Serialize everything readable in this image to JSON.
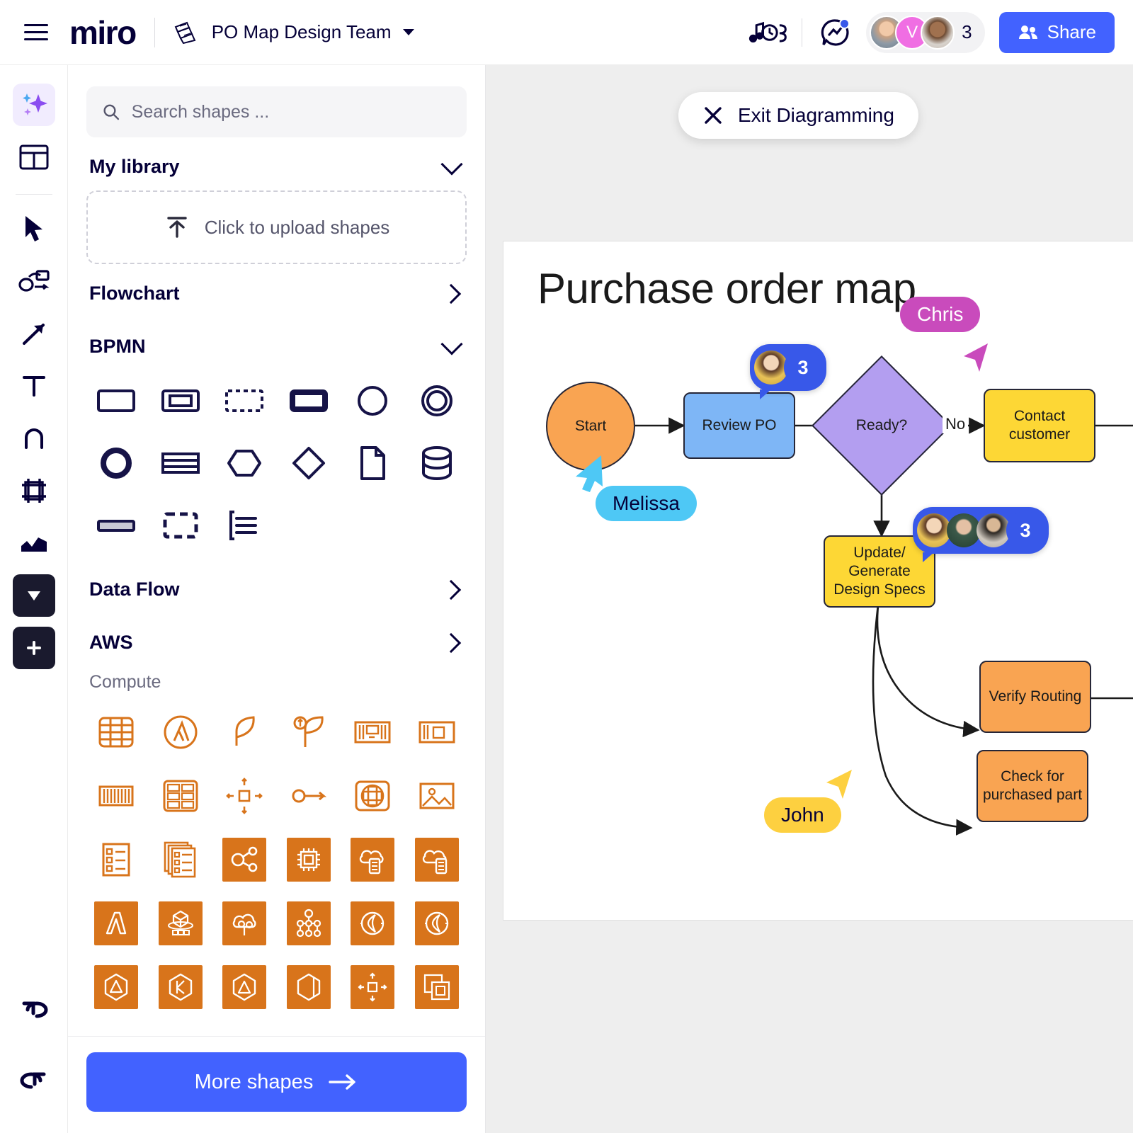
{
  "header": {
    "logo_text": "miro",
    "board_name": "PO Map Design Team",
    "board_icon": "book-icon",
    "menu_icon": "hamburger-menu-icon",
    "board_chevron_icon": "chevron-down-icon",
    "music_icon": "music-timer-icon",
    "activity_icon": "activity-chat-icon",
    "avatar_initial": "V",
    "collaborator_count": "3",
    "share_label": "Share",
    "share_icon": "people-icon",
    "accent_blue": "#4262ff"
  },
  "toolbar": {
    "items": [
      {
        "name": "ai-sparkle",
        "icon": "sparkle-icon"
      },
      {
        "name": "templates",
        "icon": "templates-icon"
      },
      {
        "name": "select",
        "icon": "cursor-arrow-icon"
      },
      {
        "name": "shapes-connector",
        "icon": "shapes-connector-icon"
      },
      {
        "name": "arrow",
        "icon": "arrow-diagonal-icon"
      },
      {
        "name": "text",
        "icon": "text-t-icon"
      },
      {
        "name": "pen",
        "icon": "pen-icon"
      },
      {
        "name": "frame",
        "icon": "frame-icon"
      },
      {
        "name": "upload-media",
        "icon": "image-chart-icon"
      },
      {
        "name": "comment",
        "icon": "comment-icon"
      },
      {
        "name": "more-apps",
        "icon": "plus-icon"
      }
    ],
    "undo_icon": "undo-icon",
    "redo_icon": "redo-icon"
  },
  "panel": {
    "search": {
      "placeholder": "Search shapes ...",
      "value": "",
      "icon": "search-icon"
    },
    "my_library": {
      "label": "My library",
      "chevron": "chevron-down-icon"
    },
    "upload": {
      "label": "Click to upload shapes",
      "icon": "upload-icon"
    },
    "flowchart": {
      "label": "Flowchart",
      "chevron": "chevron-right-icon"
    },
    "bpmn": {
      "label": "BPMN",
      "chevron": "chevron-down-icon"
    },
    "bpmn_shapes": [
      "task-rectangle",
      "subprocess-rectangle",
      "dashed-rectangle",
      "thick-rectangle",
      "event-circle",
      "end-event-double-circle",
      "bold-circle",
      "banded-rectangle",
      "hexagon",
      "diamond-gateway",
      "document",
      "data-store-cylinder",
      "filled-bar",
      "dashed-corner-rectangle",
      "annotation-list"
    ],
    "data_flow": {
      "label": "Data Flow",
      "chevron": "chevron-right-icon"
    },
    "aws": {
      "label": "AWS",
      "chevron": "chevron-right-icon"
    },
    "aws_subsection": "Compute",
    "aws_shapes": [
      {
        "name": "aws-grid-table",
        "style": "outline"
      },
      {
        "name": "aws-lambda-circle",
        "style": "outline"
      },
      {
        "name": "aws-leaf",
        "style": "outline"
      },
      {
        "name": "aws-leaf-growth",
        "style": "outline"
      },
      {
        "name": "aws-server-rack",
        "style": "outline"
      },
      {
        "name": "aws-chip-frame",
        "style": "outline"
      },
      {
        "name": "aws-barcode",
        "style": "outline"
      },
      {
        "name": "aws-rack-units",
        "style": "outline"
      },
      {
        "name": "aws-auto-scaling",
        "style": "outline"
      },
      {
        "name": "aws-endpoint-arrow",
        "style": "outline"
      },
      {
        "name": "aws-elastic-beanstalk",
        "style": "outline"
      },
      {
        "name": "aws-image",
        "style": "outline"
      },
      {
        "name": "aws-task-list",
        "style": "outline"
      },
      {
        "name": "aws-task-list-stack",
        "style": "outline"
      },
      {
        "name": "aws-share-nodes",
        "style": "filled"
      },
      {
        "name": "aws-processor",
        "style": "filled"
      },
      {
        "name": "aws-cloud-server",
        "style": "filled"
      },
      {
        "name": "aws-cloud-server-alt",
        "style": "filled"
      },
      {
        "name": "aws-lambda",
        "style": "filled"
      },
      {
        "name": "aws-batch-cube",
        "style": "filled"
      },
      {
        "name": "aws-cloud-tree",
        "style": "filled"
      },
      {
        "name": "aws-node-network",
        "style": "filled"
      },
      {
        "name": "aws-lightsail",
        "style": "filled"
      },
      {
        "name": "aws-lightsail-alt",
        "style": "filled"
      },
      {
        "name": "aws-hexagon-a",
        "style": "filled"
      },
      {
        "name": "aws-hexagon-k",
        "style": "filled"
      },
      {
        "name": "aws-hexagon-b",
        "style": "filled"
      },
      {
        "name": "aws-hexagon-open",
        "style": "filled"
      },
      {
        "name": "aws-autoscale-chip",
        "style": "filled"
      },
      {
        "name": "aws-chip-copy",
        "style": "filled"
      }
    ],
    "more_shapes": {
      "label": "More shapes",
      "icon": "arrow-right-icon"
    }
  },
  "canvas": {
    "exit_button": {
      "label": "Exit Diagramming",
      "icon": "close-x-icon"
    },
    "frame_title": "Purchase order map",
    "nodes": [
      {
        "id": "start",
        "label": "Start",
        "shape": "circle",
        "color": "#f9a452"
      },
      {
        "id": "review",
        "label": "Review PO",
        "shape": "rect",
        "color": "#7eb6f6"
      },
      {
        "id": "ready",
        "label": "Ready?",
        "shape": "diamond",
        "color": "#b39ef0"
      },
      {
        "id": "contact",
        "label": "Contact customer",
        "shape": "rect",
        "color": "#fdd735"
      },
      {
        "id": "update",
        "label": "Update/ Generate Design Specs",
        "shape": "rect",
        "color": "#fdd735"
      },
      {
        "id": "verify",
        "label": "Verify Routing",
        "shape": "rect",
        "color": "#f9a452"
      },
      {
        "id": "check",
        "label": "Check for purchased part",
        "shape": "rect",
        "color": "#f9a452"
      }
    ],
    "edge_labels": [
      {
        "id": "no",
        "label": "No"
      }
    ],
    "cursors": [
      {
        "name": "Melissa",
        "color": "#4ec8f5",
        "text_color": "#050038"
      },
      {
        "name": "Chris",
        "color": "#c94bbc",
        "text_color": "#ffffff"
      },
      {
        "name": "John",
        "color": "#fdd040",
        "text_color": "#050038"
      }
    ],
    "comments": [
      {
        "id": "review-comment",
        "count": "3",
        "avatars": 1
      },
      {
        "id": "update-comment",
        "count": "3",
        "avatars": 3
      }
    ]
  }
}
